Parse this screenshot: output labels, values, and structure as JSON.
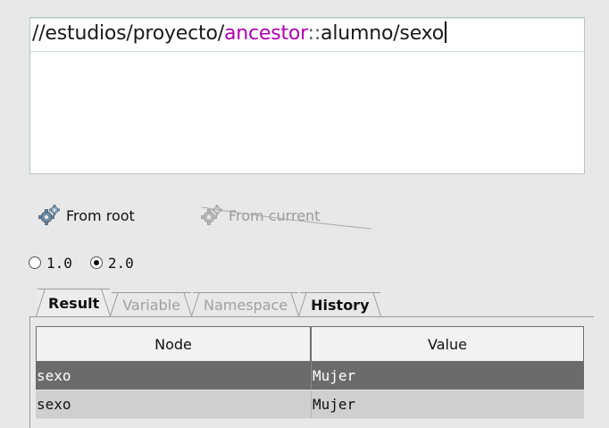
{
  "editor": {
    "segments": {
      "prefix": "//estudios/proyecto/",
      "axis_name": "ancestor",
      "axis_sep": "::",
      "suffix": "alumno/sexo"
    }
  },
  "actions": {
    "from_root_label": "From root",
    "from_current_label": "From current"
  },
  "version": {
    "options": [
      "1.0",
      "2.0"
    ],
    "selected": "2.0"
  },
  "tabs": [
    {
      "label": "Result",
      "active": true
    },
    {
      "label": "Variable",
      "active": false
    },
    {
      "label": "Namespace",
      "active": false
    },
    {
      "label": "History",
      "active": false
    }
  ],
  "results": {
    "columns": [
      "Node",
      "Value"
    ],
    "rows": [
      {
        "node": "sexo",
        "value": "Mujer",
        "selected": true
      },
      {
        "node": "sexo",
        "value": "Mujer",
        "selected": false
      }
    ]
  },
  "colors": {
    "axis_keyword": "#b000b0",
    "selected_row": "#6b6b6b",
    "normal_row": "#cfcfcf"
  },
  "icons": [
    "gear-icon",
    "gear-icon-disabled"
  ]
}
